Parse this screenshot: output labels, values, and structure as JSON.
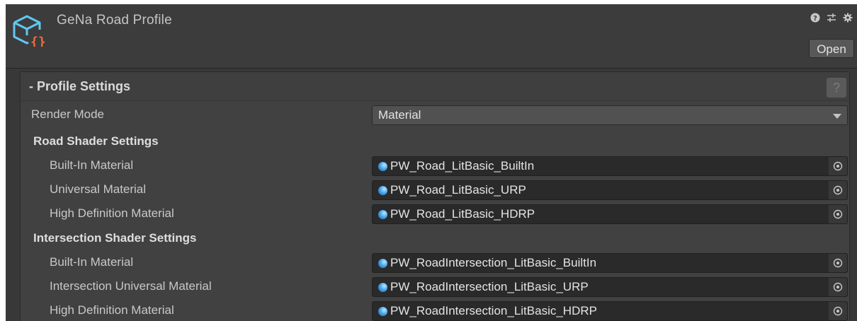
{
  "header": {
    "title": "GeNa Road Profile",
    "open_label": "Open",
    "icons": [
      "help-icon",
      "preset-sliders-icon",
      "settings-gear-icon"
    ]
  },
  "section": {
    "title": "- Profile Settings",
    "help_label": "?"
  },
  "render_mode": {
    "label": "Render Mode",
    "value": "Material"
  },
  "road_shader": {
    "title": "Road Shader Settings",
    "fields": [
      {
        "label": "Built-In Material",
        "value": "PW_Road_LitBasic_BuiltIn"
      },
      {
        "label": "Universal Material",
        "value": "PW_Road_LitBasic_URP"
      },
      {
        "label": "High Definition Material",
        "value": "PW_Road_LitBasic_HDRP"
      }
    ]
  },
  "intersection_shader": {
    "title": "Intersection Shader Settings",
    "fields": [
      {
        "label": "Built-In Material",
        "value": "PW_RoadIntersection_LitBasic_BuiltIn"
      },
      {
        "label": "Intersection Universal Material",
        "value": "PW_RoadIntersection_LitBasic_URP"
      },
      {
        "label": "High Definition Material",
        "value": "PW_RoadIntersection_LitBasic_HDRP"
      }
    ]
  },
  "colors": {
    "inspector_bg": "#383838",
    "panel_bg": "#414141",
    "field_bg": "#2a2a2a",
    "asset_icon_blue": "#5fc8f0",
    "asset_icon_orange": "#ef6b3d"
  }
}
